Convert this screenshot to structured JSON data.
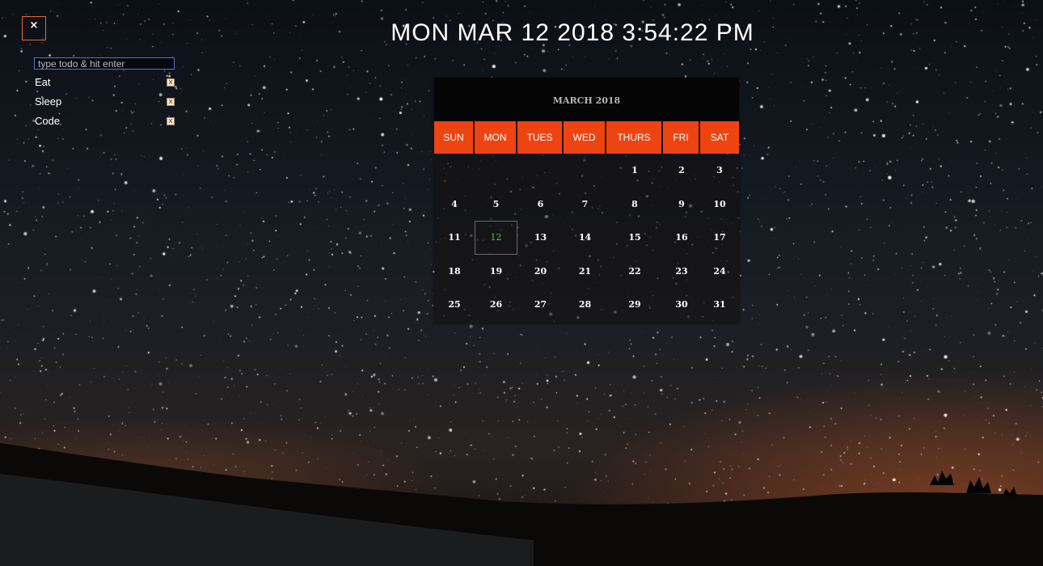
{
  "close_button": {
    "label": "×"
  },
  "clock": {
    "text": "MON MAR 12 2018 3:54:22 PM"
  },
  "todo": {
    "placeholder": "type todo & hit enter",
    "value": "",
    "delete_label": "x",
    "items": [
      {
        "label": "Eat"
      },
      {
        "label": "Sleep"
      },
      {
        "label": "Code"
      }
    ]
  },
  "calendar": {
    "title": "MARCH 2018",
    "days": [
      "SUN",
      "MON",
      "TUES",
      "WED",
      "THURS",
      "FRI",
      "SAT"
    ],
    "weeks": [
      [
        "",
        "",
        "",
        "",
        "1",
        "2",
        "3"
      ],
      [
        "4",
        "5",
        "6",
        "7",
        "8",
        "9",
        "10"
      ],
      [
        "11",
        "12",
        "13",
        "14",
        "15",
        "16",
        "17"
      ],
      [
        "18",
        "19",
        "20",
        "21",
        "22",
        "23",
        "24"
      ],
      [
        "25",
        "26",
        "27",
        "28",
        "29",
        "30",
        "31"
      ]
    ],
    "today": "12"
  },
  "colors": {
    "accent": "#ee4411",
    "today": "#2ecc40"
  }
}
